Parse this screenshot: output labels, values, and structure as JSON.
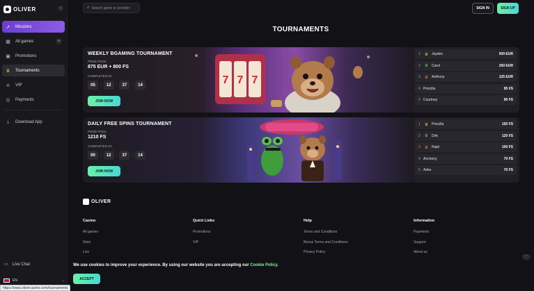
{
  "brand": {
    "name": "OLIVER"
  },
  "sidebar": {
    "items": [
      {
        "label": "Missions",
        "icon": "rocket-icon"
      },
      {
        "label": "All games",
        "icon": "grid-icon"
      },
      {
        "label": "Promotions",
        "icon": "gift-icon"
      },
      {
        "label": "Tournaments",
        "icon": "trophy-icon"
      },
      {
        "label": "VIP",
        "icon": "crown-icon"
      },
      {
        "label": "Payments",
        "icon": "coin-icon"
      },
      {
        "label": "Download App",
        "icon": "download-icon"
      }
    ],
    "live_chat": "Live Chat",
    "language": "EN"
  },
  "header": {
    "search_placeholder": "Search game or provider",
    "sign_in": "SIGN IN",
    "sign_up": "SIGN UP"
  },
  "page": {
    "title": "TOURNAMENTS"
  },
  "tournaments": [
    {
      "title": "WEEKLY BGAMING TOURNAMENT",
      "prize_label": "PRIZE POOL",
      "prize": "875 EUR + 800 FS",
      "completed_label": "COMPLETED IN:",
      "timer": [
        "05",
        "12",
        "37",
        "14"
      ],
      "join": "JOIN NOW",
      "leaderboard": [
        {
          "rank": "1",
          "name": "Jayden",
          "prize": "500 EUR",
          "crown": "gold"
        },
        {
          "rank": "2",
          "name": "Carol",
          "prize": "250 EUR",
          "crown": "green"
        },
        {
          "rank": "3",
          "name": "Anthony",
          "prize": "125 EUR",
          "crown": "orange"
        },
        {
          "rank": "4",
          "name": "Priscilla",
          "prize": "95 FS"
        },
        {
          "rank": "5",
          "name": "Courtney",
          "prize": "90 FS"
        }
      ]
    },
    {
      "title": "DAILY FREE SPINS TOURNAMENT",
      "prize_label": "PRIZE POOL",
      "prize": "1210 FS",
      "completed_label": "COMPLETED IN:",
      "timer": [
        "00",
        "12",
        "37",
        "14"
      ],
      "join": "JOIN NOW",
      "leaderboard": [
        {
          "rank": "1",
          "name": "Priscilla",
          "prize": "150 FS",
          "crown": "gold"
        },
        {
          "rank": "2",
          "name": "Dirk",
          "prize": "120 FS",
          "crown": "green"
        },
        {
          "rank": "3",
          "name": "Rajni",
          "prize": "100 FS",
          "crown": "orange"
        },
        {
          "rank": "4",
          "name": "Anchony",
          "prize": "70 FS"
        },
        {
          "rank": "5",
          "name": "Anke",
          "prize": "70 FS"
        }
      ]
    }
  ],
  "footer": {
    "columns": [
      {
        "title": "Casino",
        "links": [
          "All games",
          "Slots",
          "Live"
        ]
      },
      {
        "title": "Quick Links",
        "links": [
          "Promotions",
          "VIP"
        ]
      },
      {
        "title": "Help",
        "links": [
          "Terms and Conditions",
          "Bonus Terms and Conditions",
          "Privacy Policy"
        ]
      },
      {
        "title": "Information",
        "links": [
          "Payments",
          "Support",
          "About us"
        ]
      }
    ]
  },
  "cookie": {
    "text": "We use cookies to improve your experience. By using our website you are accepting our ",
    "link": "Cookie Policy",
    "end": ".",
    "accept": "ACCEPT"
  },
  "status_url": "https://www.olivercasino.com/tournaments",
  "colors": {
    "accent_gradient_start": "#6cf0a9",
    "accent_gradient_end": "#48d8d3",
    "missions": "#7b4fe0",
    "background": "#121116"
  }
}
